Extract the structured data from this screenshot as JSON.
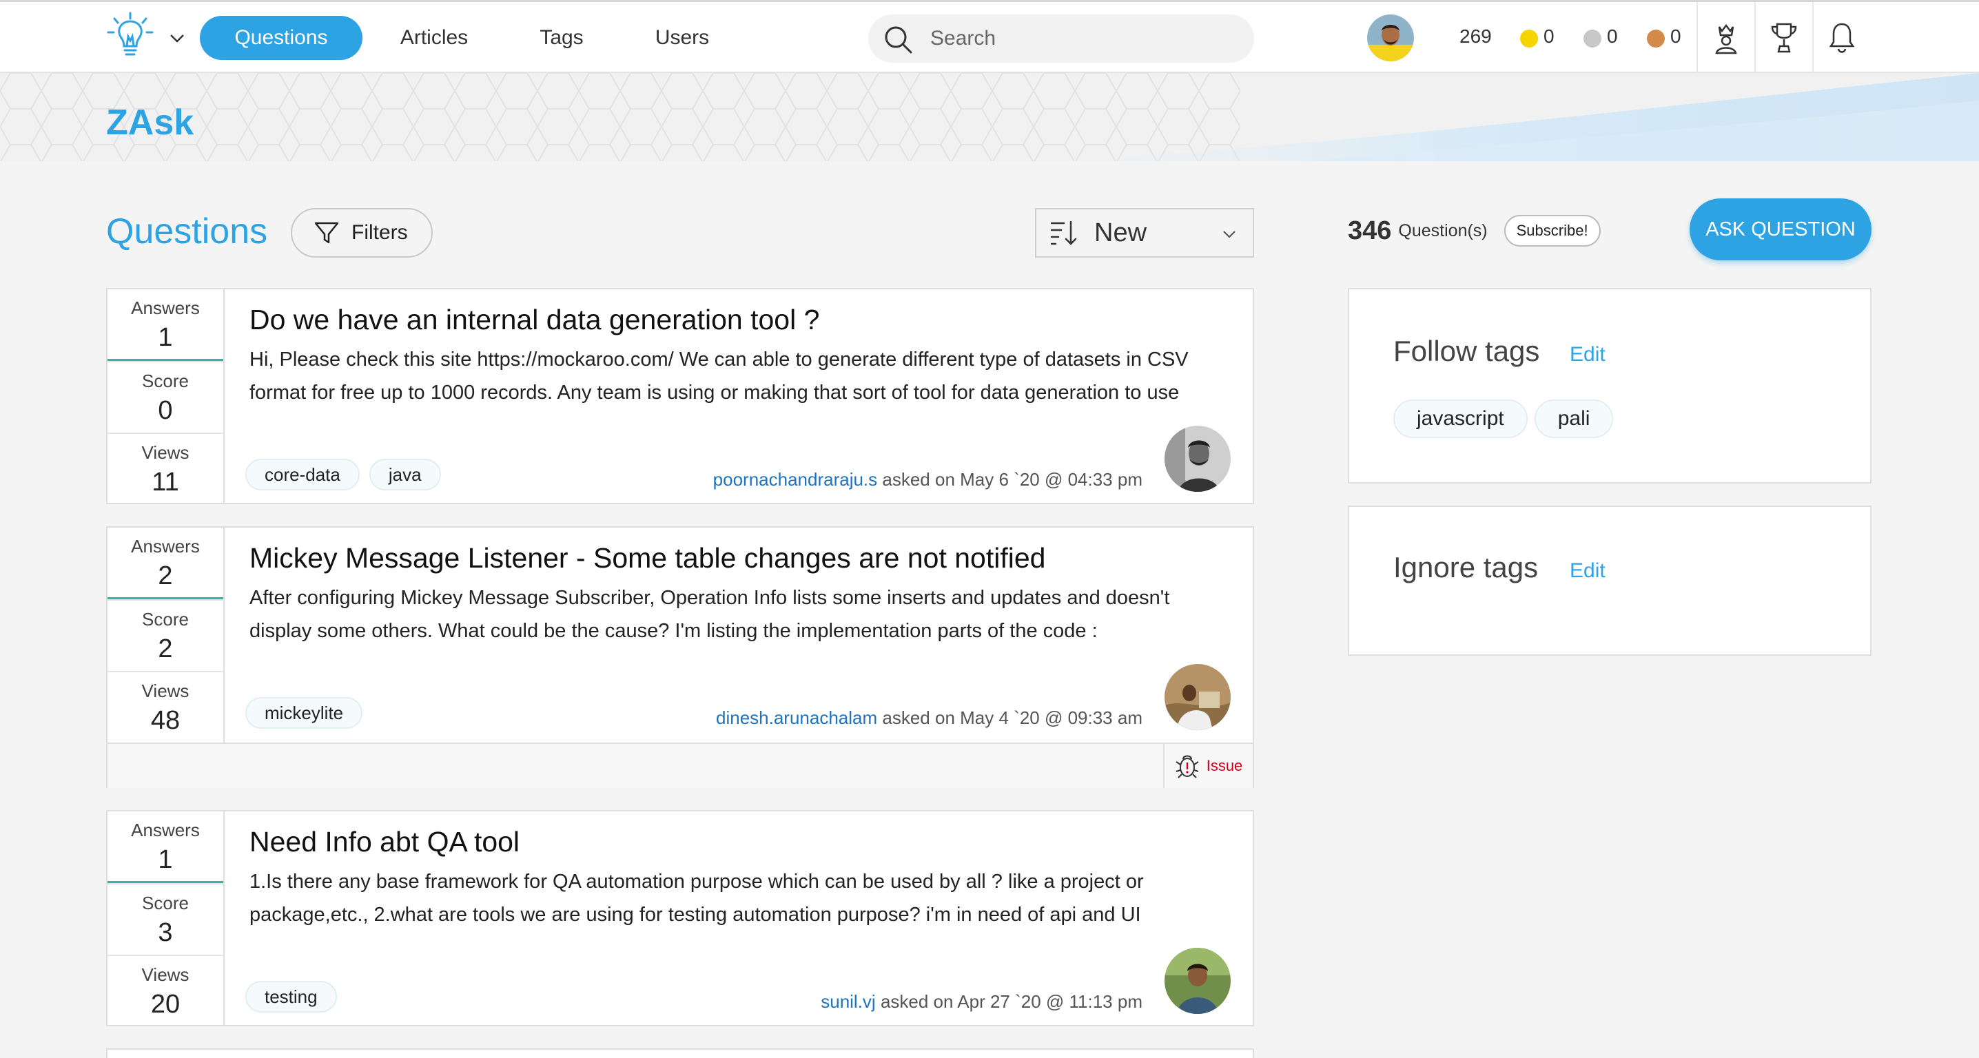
{
  "nav": {
    "items": [
      {
        "label": "Questions",
        "active": true
      },
      {
        "label": "Articles",
        "active": false
      },
      {
        "label": "Tags",
        "active": false
      },
      {
        "label": "Users",
        "active": false
      }
    ],
    "search_placeholder": "Search",
    "reputation": "269",
    "badges": [
      {
        "color": "#f5d400",
        "count": "0",
        "icon": "gold-badge-icon"
      },
      {
        "color": "#c8c8c8",
        "count": "0",
        "icon": "silver-badge-icon"
      },
      {
        "color": "#d48a4a",
        "count": "0",
        "icon": "bronze-badge-icon"
      }
    ],
    "icons": [
      "leaderboard-icon",
      "trophy-icon",
      "bell-icon"
    ]
  },
  "banner": {
    "brand": "ZAsk"
  },
  "list": {
    "title": "Questions",
    "filters_label": "Filters",
    "sort_label": "New"
  },
  "questions": [
    {
      "stats": [
        {
          "name": "Answers",
          "value": "1"
        },
        {
          "name": "Score",
          "value": "0"
        },
        {
          "name": "Views",
          "value": "11"
        }
      ],
      "title": "Do we have an internal data generation tool ?",
      "excerpt": "Hi, Please check this site https://mockaroo.com/ We can able to generate different type of datasets in CSV format for free up to 1000 records. Any team is using or making that sort of tool for data generation to use",
      "tags": [
        "core-data",
        "java"
      ],
      "user": "poornachandraraju.s",
      "asked": "asked on May 6 `20 @ 04:33 pm"
    },
    {
      "stats": [
        {
          "name": "Answers",
          "value": "2"
        },
        {
          "name": "Score",
          "value": "2"
        },
        {
          "name": "Views",
          "value": "48"
        }
      ],
      "title": "Mickey Message Listener - Some table changes are not notified",
      "excerpt": "After configuring Mickey Message Subscriber, Operation Info lists some inserts and updates and doesn't display some others. What could be the cause? I'm listing the implementation parts of the code :",
      "tags": [
        "mickeylite"
      ],
      "user": "dinesh.arunachalam",
      "asked": "asked on May 4 `20 @ 09:33 am",
      "issue_label": "Issue"
    },
    {
      "stats": [
        {
          "name": "Answers",
          "value": "1"
        },
        {
          "name": "Score",
          "value": "3"
        },
        {
          "name": "Views",
          "value": "20"
        }
      ],
      "title": "Need Info abt QA tool",
      "excerpt": "1.Is there any base framework for QA automation purpose which can be used by all ? like a project or package,etc., 2.what are tools we are using for testing automation purpose? i'm in need of api and UI",
      "tags": [
        "testing"
      ],
      "user": "sunil.vj",
      "asked": "asked on Apr 27 `20 @ 11:13 pm"
    }
  ],
  "sidebar": {
    "count": "346",
    "count_label": "Question(s)",
    "subscribe_label": "Subscribe!",
    "ask_label": "ASK QUESTION",
    "follow": {
      "title": "Follow tags",
      "edit": "Edit",
      "tags": [
        "javascript",
        "pali"
      ]
    },
    "ignore": {
      "title": "Ignore tags",
      "edit": "Edit"
    }
  },
  "colors": {
    "accent": "#2ea3e3",
    "link": "#1e73be",
    "issue": "#d0021b",
    "answers_bar": "#3fb0a6"
  }
}
